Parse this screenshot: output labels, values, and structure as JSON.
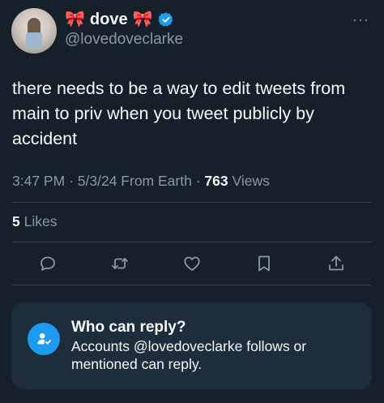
{
  "author": {
    "display_name": "dove",
    "bow_emoji": "🎀",
    "handle": "@lovedoveclarke",
    "verified": true
  },
  "menu": {
    "more_label": "···"
  },
  "tweet": {
    "text": "there needs to be a way to edit tweets from main to priv when you tweet publicly by accident",
    "time": "3:47 PM",
    "date": "5/3/24",
    "source": "From Earth",
    "views_count": "763",
    "views_label": "Views",
    "likes_count": "5",
    "likes_label": "Likes"
  },
  "actions": [
    {
      "name": "reply",
      "icon": "reply-icon"
    },
    {
      "name": "retweet",
      "icon": "retweet-icon"
    },
    {
      "name": "like",
      "icon": "heart-icon"
    },
    {
      "name": "bookmark",
      "icon": "bookmark-icon"
    },
    {
      "name": "share",
      "icon": "share-icon"
    }
  ],
  "reply_settings": {
    "title": "Who can reply?",
    "description": "Accounts @lovedoveclarke follows or mentioned can reply."
  },
  "colors": {
    "background": "#15202b",
    "accent": "#1d9bf0",
    "secondary_text": "#8b98a5",
    "card": "#1e2d3c"
  }
}
